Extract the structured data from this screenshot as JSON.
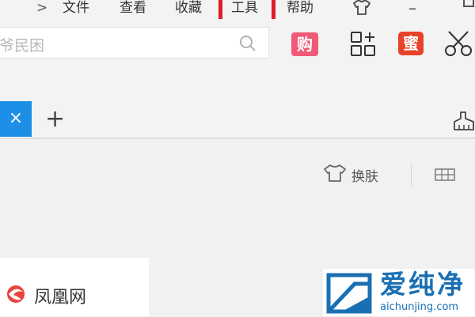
{
  "menubar": {
    "chevron": ">",
    "items": [
      "文件",
      "查看",
      "收藏",
      "工具",
      "帮助"
    ],
    "highlighted": "工具"
  },
  "window_controls": {
    "minimize": "–",
    "skin_shirt": "shirt-icon"
  },
  "search": {
    "value": "爷民困"
  },
  "toolbar": {
    "shop_label": "购",
    "honey_label": "蜜"
  },
  "tabs": {
    "close_label": "×",
    "add_label": "+"
  },
  "content": {
    "skin_label": "换肤"
  },
  "news_card": {
    "label": "凤凰网"
  },
  "watermark": {
    "cn": "爱纯净",
    "en": "aichunjing.com"
  },
  "colors": {
    "accent_blue": "#1e8fe6",
    "highlight_red": "#e01b2a",
    "shop_pink": "#f05a78",
    "honey_orange": "#e8432a",
    "watermark_blue": "#1a6fb3"
  }
}
